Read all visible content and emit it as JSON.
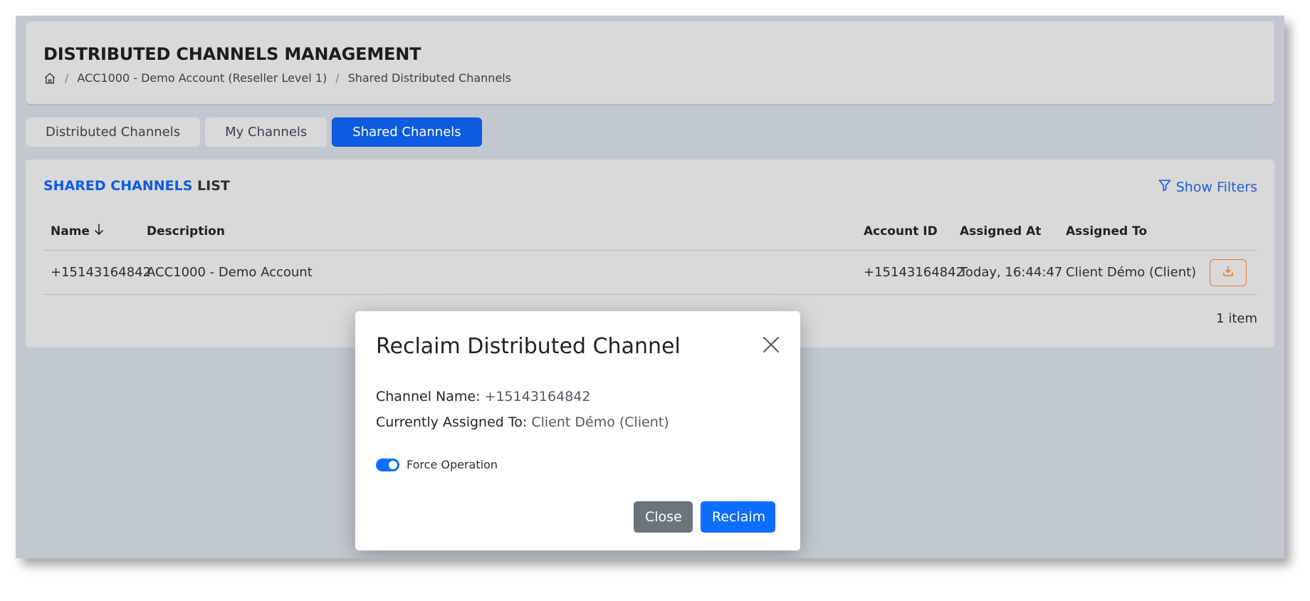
{
  "header": {
    "title": "DISTRIBUTED CHANNELS MANAGEMENT",
    "breadcrumb": {
      "home_icon": "home-icon",
      "items": [
        "ACC1000 - Demo Account (Reseller Level 1)",
        "Shared Distributed Channels"
      ],
      "separator": "/"
    }
  },
  "tabs": [
    {
      "label": "Distributed Channels",
      "active": false
    },
    {
      "label": "My Channels",
      "active": false
    },
    {
      "label": "Shared Channels",
      "active": true
    }
  ],
  "list": {
    "title_accent": "SHARED CHANNELS",
    "title_rest": "LIST",
    "filters_label": "Show Filters",
    "filters_icon": "filter-icon",
    "columns": {
      "name": "Name",
      "description": "Description",
      "account_id": "Account ID",
      "assigned_at": "Assigned At",
      "assigned_to": "Assigned To"
    },
    "sort_icon": "arrow-down-icon",
    "rows": [
      {
        "name": "+15143164842",
        "description": "ACC1000 - Demo Account",
        "account_id": "+15143164842",
        "assigned_at": "Today, 16:44:47",
        "assigned_to": "Client Démo (Client)",
        "action_icon": "reclaim-download-icon"
      }
    ],
    "count": "1 item"
  },
  "modal": {
    "title": "Reclaim Distributed Channel",
    "channel_name_label": "Channel Name:",
    "channel_name_value": "+15143164842",
    "assigned_to_label": "Currently Assigned To:",
    "assigned_to_value": "Client Démo (Client)",
    "force_label": "Force Operation",
    "force_enabled": true,
    "close_label": "Close",
    "reclaim_label": "Reclaim"
  },
  "colors": {
    "primary": "#0d6efd",
    "tab_active": "#0d5ce3",
    "secondary": "#6c757d",
    "warning_outline": "#e07a2c",
    "backdrop": "#c3c8d0"
  }
}
